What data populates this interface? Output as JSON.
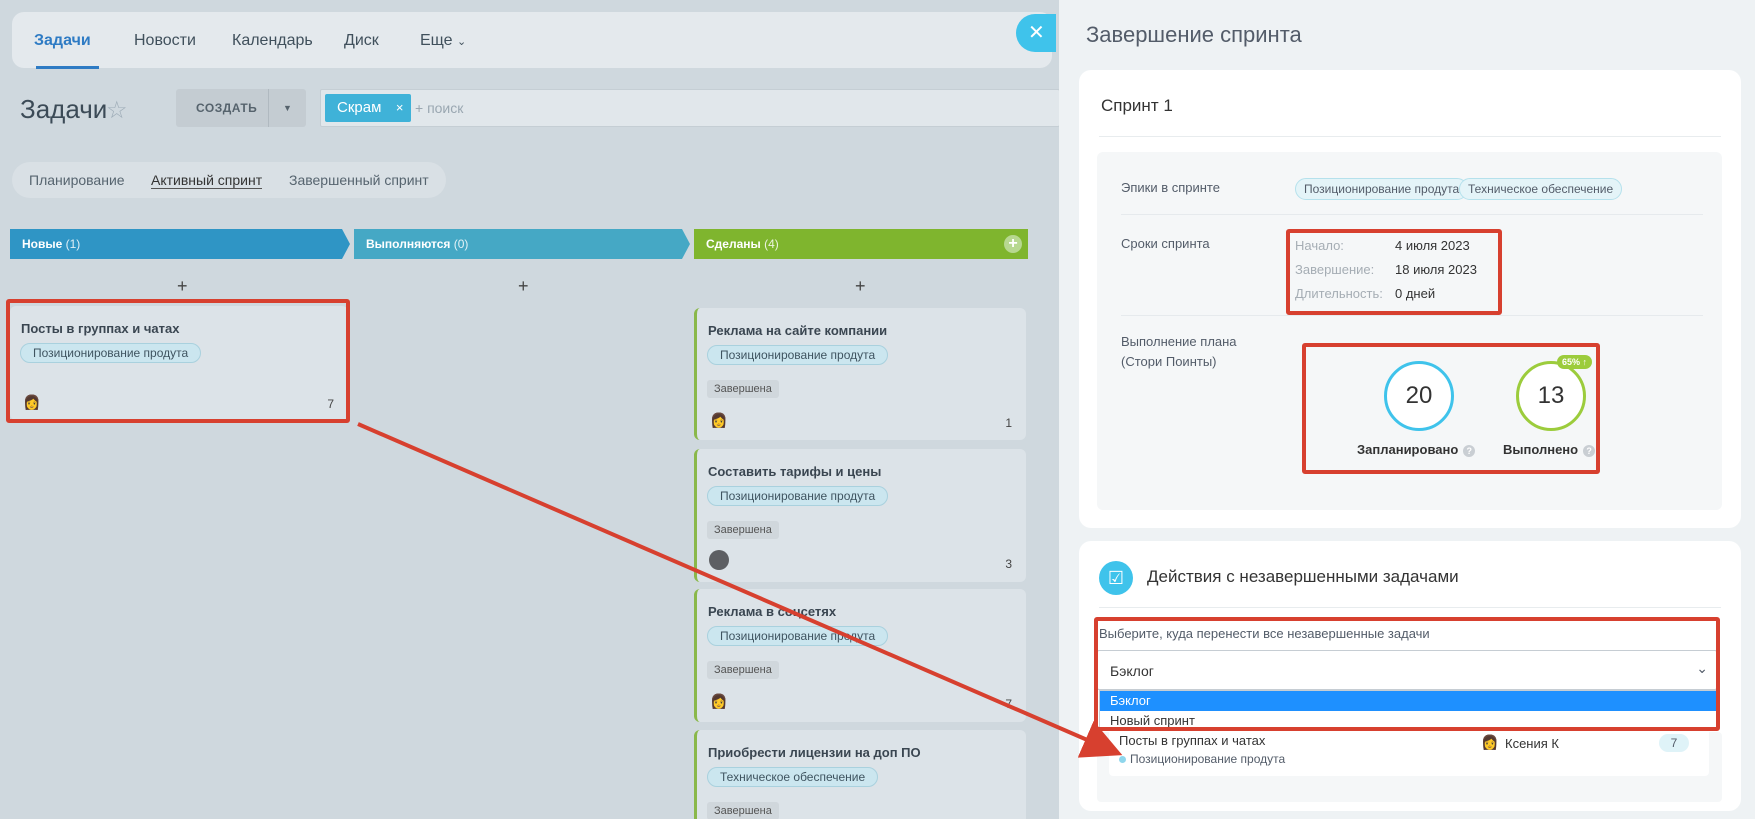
{
  "nav": {
    "tabs": [
      "Задачи",
      "Новости",
      "Календарь",
      "Диск",
      "Еще"
    ],
    "more_chevron": "chevron-down-icon"
  },
  "board": {
    "title": "Задачи",
    "create_label": "СОЗДАТЬ",
    "search_chip": "Скрам",
    "search_placeholder": "+ поиск",
    "scrum_tabs": [
      "Планирование",
      "Активный спринт",
      "Завершенный спринт"
    ],
    "columns": [
      {
        "name": "Новые",
        "count": "(1)",
        "color": "#2f95c5"
      },
      {
        "name": "Выполняются",
        "count": "(0)",
        "color": "#45a8c5"
      },
      {
        "name": "Сделаны",
        "count": "(4)",
        "color": "#7fb52e"
      }
    ],
    "new_cards": [
      {
        "title": "Посты в группах и чатах",
        "epic": "Позиционирование продута",
        "points": "7"
      }
    ],
    "done_cards": [
      {
        "title": "Реклама на сайте компании",
        "epic": "Позиционирование продута",
        "status": "Завершена",
        "points": "1"
      },
      {
        "title": "Составить тарифы и цены",
        "epic": "Позиционирование продута",
        "status": "Завершена",
        "points": "3"
      },
      {
        "title": "Реклама в соцсетях",
        "epic": "Позиционирование продута",
        "status": "Завершена",
        "points": "7"
      },
      {
        "title": "Приобрести лицензии на доп ПО",
        "epic": "Техническое обеспечение",
        "status": "Завершена",
        "points": ""
      }
    ]
  },
  "panel": {
    "title": "Завершение спринта",
    "sprint_name": "Спринт 1",
    "epics_label": "Эпики в спринте",
    "epics": [
      "Позиционирование продута",
      "Техническое обеспечение"
    ],
    "dates_label": "Сроки спринта",
    "dates": {
      "start_key": "Начало:",
      "start_val": "4 июля 2023",
      "end_key": "Завершение:",
      "end_val": "18 июля 2023",
      "dur_key": "Длительность:",
      "dur_val": "0 дней"
    },
    "plan_label_1": "Выполнение плана",
    "plan_label_2": "(Стори Поинты)",
    "planned": {
      "value": "20",
      "label": "Запланировано"
    },
    "done": {
      "value": "13",
      "label": "Выполнено",
      "badge": "65% ↑"
    },
    "actions": {
      "title": "Действия с незавершенными задачами",
      "move_label": "Выберите, куда перенести все незавершенные задачи",
      "select_value": "Бэклог",
      "options": [
        "Бэклог",
        "Новый спринт"
      ],
      "task": {
        "name": "Посты в группах и чатах",
        "epic": "Позиционирование продута",
        "user": "Ксения К",
        "points": "7"
      }
    },
    "colors": {
      "accent": "#3fc3eb",
      "done": "#9ccc3c",
      "highlight": "#d7402f"
    }
  }
}
